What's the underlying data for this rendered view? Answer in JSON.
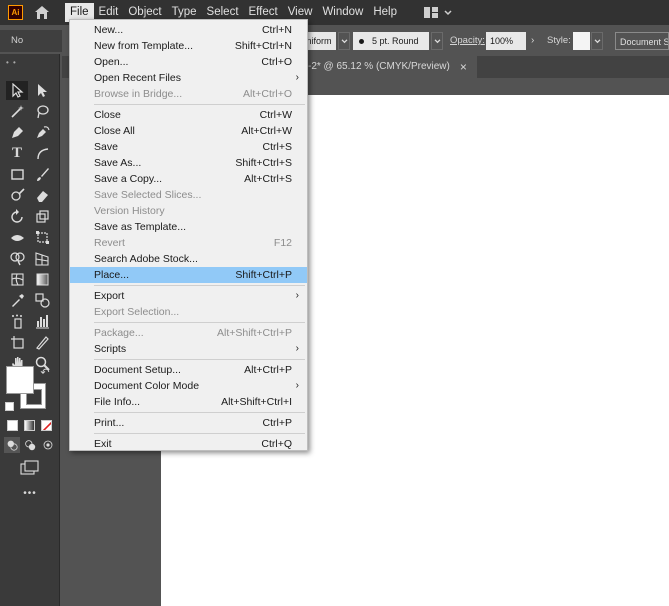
{
  "app": {
    "logo_text": "Ai",
    "menus": [
      "File",
      "Edit",
      "Object",
      "Type",
      "Select",
      "Effect",
      "View",
      "Window",
      "Help"
    ]
  },
  "control_bar": {
    "selection_label": "No Selection",
    "stroke_profile": "Uniform",
    "brush": "5 pt. Round",
    "opacity_label": "Opacity:",
    "opacity_value": "100%",
    "style_label": "Style:",
    "document_setup": "Document Setup"
  },
  "document_tab": {
    "title": "-2* @ 65.12 % (CMYK/Preview)",
    "close": "×"
  },
  "file_menu": {
    "groups": [
      [
        {
          "label": "New...",
          "shortcut": "Ctrl+N"
        },
        {
          "label": "New from Template...",
          "shortcut": "Shift+Ctrl+N"
        },
        {
          "label": "Open...",
          "shortcut": "Ctrl+O"
        },
        {
          "label": "Open Recent Files",
          "submenu": true
        },
        {
          "label": "Browse in Bridge...",
          "shortcut": "Alt+Ctrl+O",
          "disabled": true
        }
      ],
      [
        {
          "label": "Close",
          "shortcut": "Ctrl+W"
        },
        {
          "label": "Close All",
          "shortcut": "Alt+Ctrl+W"
        },
        {
          "label": "Save",
          "shortcut": "Ctrl+S"
        },
        {
          "label": "Save As...",
          "shortcut": "Shift+Ctrl+S"
        },
        {
          "label": "Save a Copy...",
          "shortcut": "Alt+Ctrl+S"
        },
        {
          "label": "Save Selected Slices...",
          "disabled": true
        },
        {
          "label": "Version History",
          "disabled": true
        },
        {
          "label": "Save as Template..."
        },
        {
          "label": "Revert",
          "shortcut": "F12",
          "disabled": true
        },
        {
          "label": "Search Adobe Stock..."
        },
        {
          "label": "Place...",
          "shortcut": "Shift+Ctrl+P",
          "highlighted": true
        }
      ],
      [
        {
          "label": "Export",
          "submenu": true
        },
        {
          "label": "Export Selection...",
          "disabled": true
        }
      ],
      [
        {
          "label": "Package...",
          "shortcut": "Alt+Shift+Ctrl+P",
          "disabled": true
        },
        {
          "label": "Scripts",
          "submenu": true
        }
      ],
      [
        {
          "label": "Document Setup...",
          "shortcut": "Alt+Ctrl+P"
        },
        {
          "label": "Document Color Mode",
          "submenu": true
        },
        {
          "label": "File Info...",
          "shortcut": "Alt+Shift+Ctrl+I"
        }
      ],
      [
        {
          "label": "Print...",
          "shortcut": "Ctrl+P"
        }
      ],
      [
        {
          "label": "Exit",
          "shortcut": "Ctrl+Q"
        }
      ]
    ]
  },
  "colors": {
    "menu_bg": "#323232",
    "dropdown_bg": "#f0f0f0",
    "highlight": "#91c9f7",
    "artboard": "#ffffff",
    "logo_accent": "#ff9a00"
  },
  "toolbar": {
    "more_label": "•••"
  }
}
